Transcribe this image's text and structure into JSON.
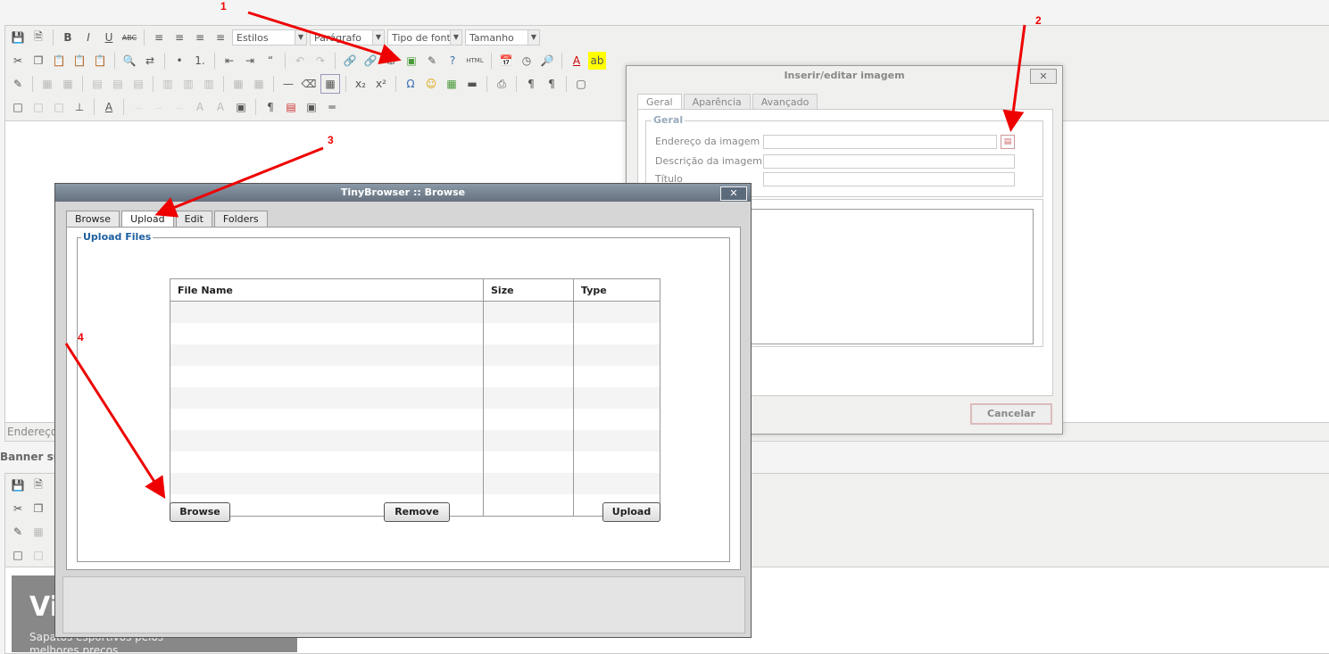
{
  "editor": {
    "styles_select": "Estilos",
    "paragraph_select": "Parágrafo",
    "font_select": "Tipo de fonte",
    "size_select": "Tamanho",
    "html_button": "HTML",
    "status_label": "Endereço:"
  },
  "second_editor": {
    "section_label": "Banner superior",
    "banner_title": "Vi",
    "banner_subtitle": "Sapatos esportivos pelos melhores preços"
  },
  "image_dialog": {
    "title": "Inserir/editar imagem",
    "close": "✕",
    "tabs": [
      "Geral",
      "Aparência",
      "Avançado"
    ],
    "legend": "Geral",
    "fields": {
      "image_url": "Endereço da imagem",
      "image_description": "Descrição da imagem",
      "title": "Título"
    },
    "cancel": "Cancelar"
  },
  "tinybrowser": {
    "title": "TinyBrowser :: Browse",
    "close": "✕",
    "tabs": [
      "Browse",
      "Upload",
      "Edit",
      "Folders"
    ],
    "legend": "Upload Files",
    "columns": [
      "File Name",
      "Size",
      "Type"
    ],
    "browse_button": "Browse",
    "remove_button": "Remove",
    "upload_button": "Upload"
  },
  "annotations": [
    "1",
    "2",
    "3",
    "4"
  ],
  "colors": {
    "arrow": "#e00000",
    "dialog_title_bar": "#6b7785",
    "legend_blue": "#1e5fa0"
  }
}
